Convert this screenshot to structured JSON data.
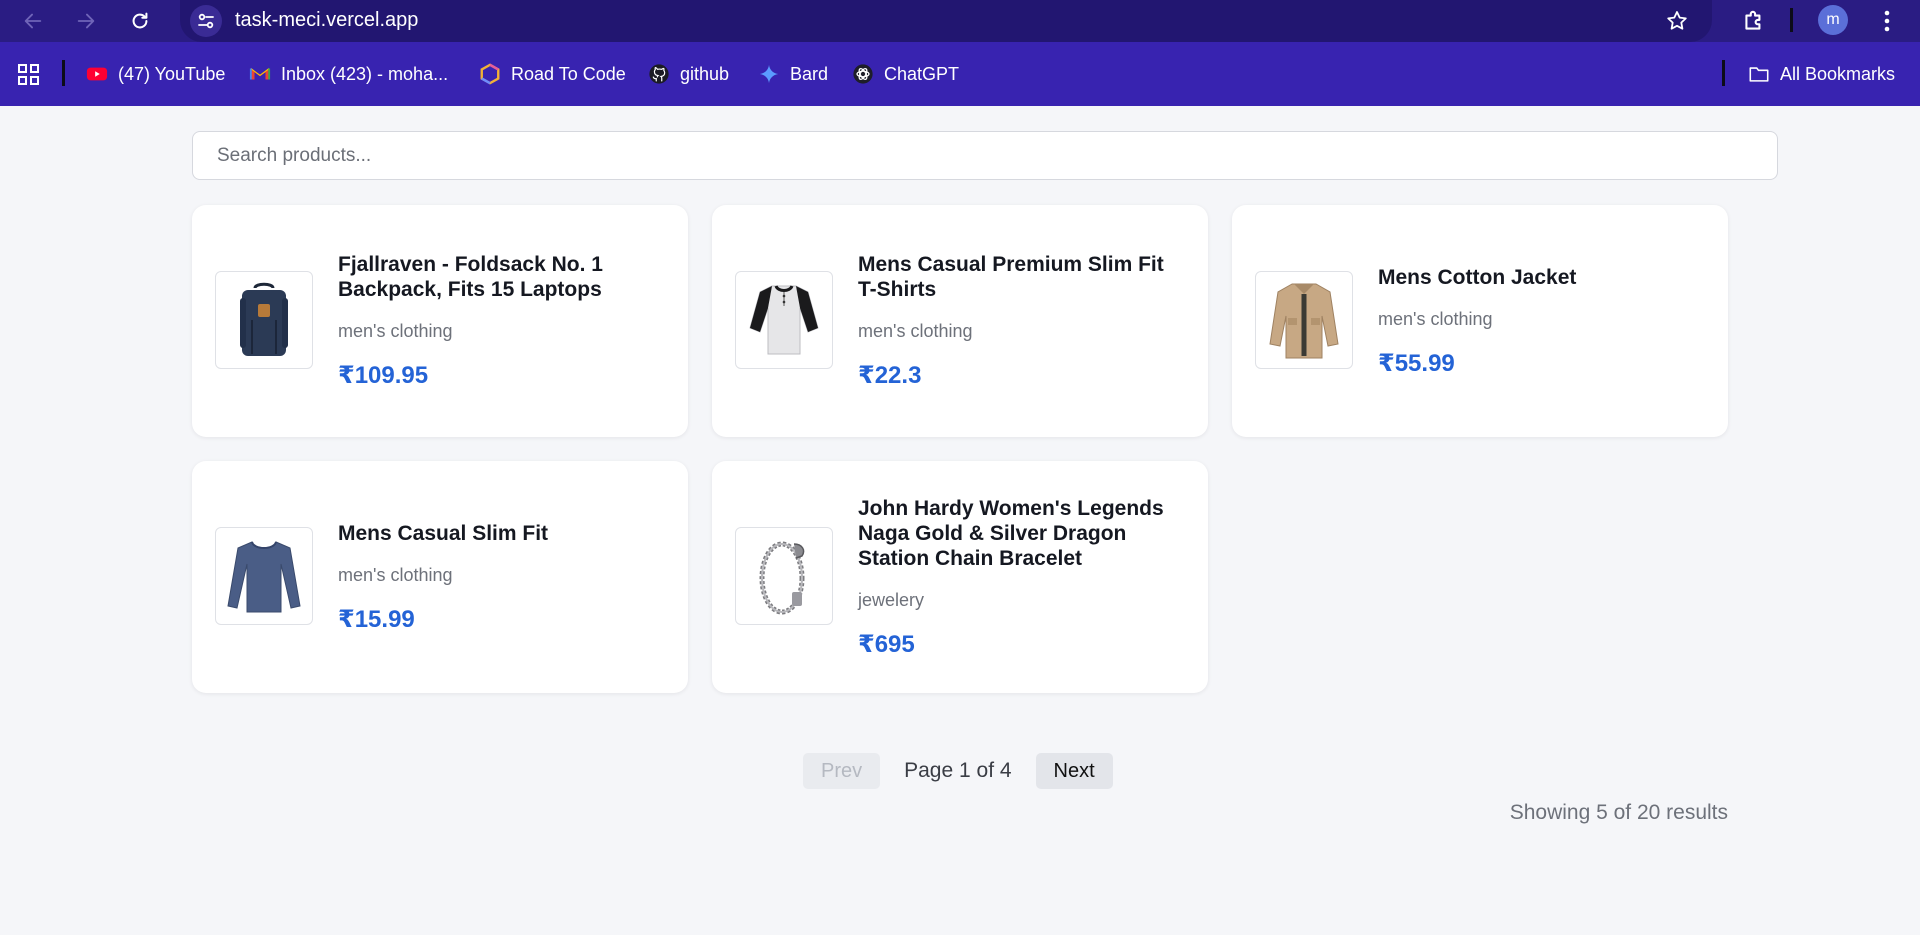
{
  "browser": {
    "url": "task-meci.vercel.app",
    "profile_initial": "m",
    "bookmarks": [
      {
        "label": "(47) YouTube",
        "icon": "youtube-icon"
      },
      {
        "label": "Inbox (423) - moha...",
        "icon": "gmail-icon"
      },
      {
        "label": "Road To Code",
        "icon": "road-to-code-icon"
      },
      {
        "label": "github",
        "icon": "github-icon"
      },
      {
        "label": "Bard",
        "icon": "bard-icon"
      },
      {
        "label": "ChatGPT",
        "icon": "chatgpt-icon"
      }
    ],
    "all_bookmarks_label": "All Bookmarks"
  },
  "search": {
    "placeholder": "Search products...",
    "value": ""
  },
  "products": [
    {
      "title": "Fjallraven - Foldsack No. 1 Backpack, Fits 15 Laptops",
      "category": "men's clothing",
      "price": "₹109.95",
      "image": "backpack"
    },
    {
      "title": "Mens Casual Premium Slim Fit T-Shirts",
      "category": "men's clothing",
      "price": "₹22.3",
      "image": "raglan-tshirt"
    },
    {
      "title": "Mens Cotton Jacket",
      "category": "men's clothing",
      "price": "₹55.99",
      "image": "jacket"
    },
    {
      "title": "Mens Casual Slim Fit",
      "category": "men's clothing",
      "price": "₹15.99",
      "image": "long-sleeve-shirt"
    },
    {
      "title": "John Hardy Women's Legends Naga Gold & Silver Dragon Station Chain Bracelet",
      "category": "jewelery",
      "price": "₹695",
      "image": "bracelet"
    }
  ],
  "pagination": {
    "prev_label": "Prev",
    "page_text": "Page 1 of 4",
    "next_label": "Next"
  },
  "results_text": "Showing 5 of 20 results",
  "colors": {
    "chrome_bar": "#3823b0",
    "toolbar": "#2a1c83",
    "price": "#2463d6",
    "page_bg": "#f5f6f9"
  }
}
